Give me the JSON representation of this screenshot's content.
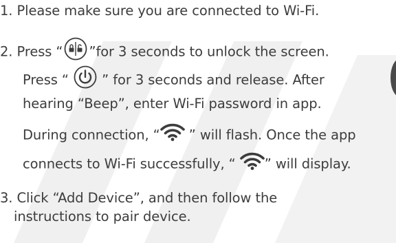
{
  "steps": [
    {
      "number": "1.",
      "lines": [
        "Please make sure you are connected to Wi-Fi."
      ]
    },
    {
      "number": "2.",
      "lines": [
        {
          "before": "Press “",
          "icon": "lock-unlock-icon",
          "after": "”for 3 seconds to unlock the screen."
        },
        {
          "before": "Press “ ",
          "icon": "power-icon",
          "after": " ” for 3 seconds and release. After"
        },
        {
          "text": "hearing “Beep”, enter Wi-Fi password in app."
        },
        {
          "before": "During connection, “",
          "icon": "wifi-icon",
          "after": " ” will flash. Once the app"
        },
        {
          "before": "connects to Wi-Fi successfully, “ ",
          "icon": "wifi-icon",
          "after": "” will display."
        }
      ]
    },
    {
      "number": "3.",
      "lines": [
        "Click “Add Device”, and then follow the",
        "instructions to pair device."
      ]
    }
  ],
  "colors": {
    "text": "#3c3c3c",
    "watermark": "#efefef",
    "icon": "#3c3c3c"
  }
}
